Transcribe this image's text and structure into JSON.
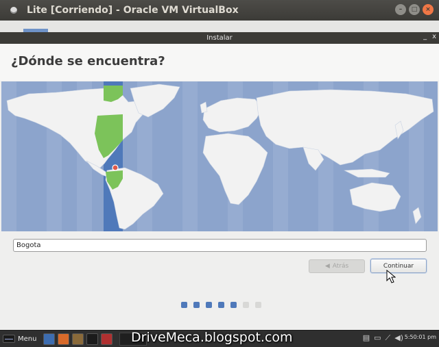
{
  "host_window": {
    "title": "Lite [Corriendo] - Oracle VM VirtualBox",
    "controls": [
      "minimize-icon",
      "maximize-icon",
      "close-icon"
    ]
  },
  "installer": {
    "window_title": "Instalar",
    "window_controls": {
      "minimize": "_",
      "close": "x"
    },
    "page_title": "¿Dónde se encuentra?",
    "location_value": "Bogota",
    "back_label": "Atrás",
    "continue_label": "Continuar",
    "progress": {
      "total_steps": 7,
      "current_step": 5
    },
    "colors": {
      "ocean": "#8ca4cc",
      "land": "#f2f2f2",
      "timezone_highlight": "#7cc35a",
      "accent": "#4f79ba"
    }
  },
  "taskbar": {
    "menu_label": "Menu",
    "clock": "5:50:01 pm",
    "watermark": "DriveMeca.blogspot.com"
  }
}
